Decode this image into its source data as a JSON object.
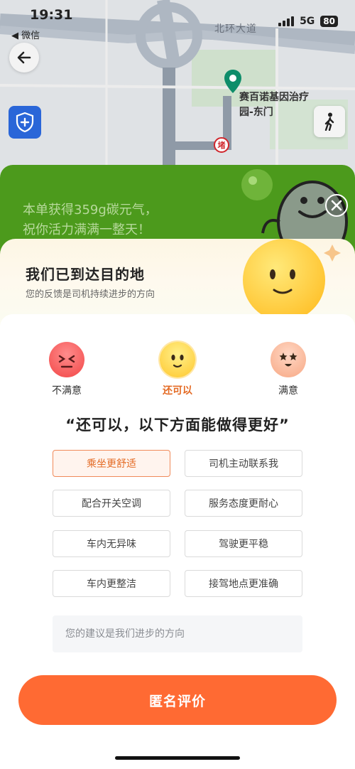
{
  "status_bar": {
    "time": "19:31",
    "back_app": "◀ 微信",
    "network": "5G",
    "battery": "80"
  },
  "map": {
    "road_name": "北环大道",
    "destination": "赛百诺基因治疗\n园-东门",
    "metro_label": "堵"
  },
  "banner": {
    "line1": "本单获得359g碳元气，",
    "line2": "祝你活力满满一整天！"
  },
  "sheet": {
    "title": "我们已到达目的地",
    "subtitle": "您的反馈是司机持续进步的方向"
  },
  "ratings": [
    {
      "label": "不满意",
      "active": false
    },
    {
      "label": "还可以",
      "active": true
    },
    {
      "label": "满意",
      "active": false
    }
  ],
  "quote": "“还可以，以下方面能做得更好”",
  "tags": [
    {
      "label": "乘坐更舒适",
      "selected": true
    },
    {
      "label": "司机主动联系我",
      "selected": false
    },
    {
      "label": "配合开关空调",
      "selected": false
    },
    {
      "label": "服务态度更耐心",
      "selected": false
    },
    {
      "label": "车内无异味",
      "selected": false
    },
    {
      "label": "驾驶更平稳",
      "selected": false
    },
    {
      "label": "车内更整洁",
      "selected": false
    },
    {
      "label": "接驾地点更准确",
      "selected": false
    }
  ],
  "suggestion": {
    "placeholder": "您的建议是我们进步的方向",
    "value": ""
  },
  "submit_label": "匿名评价",
  "colors": {
    "accent": "#ff6a33",
    "green": "#4c9a1c",
    "selected_tag_border": "#f08a5a",
    "shield_blue": "#2a66d8"
  },
  "icons": [
    "back-arrow-icon",
    "shield-plus-icon",
    "walk-icon",
    "location-pin-icon",
    "close-icon"
  ]
}
